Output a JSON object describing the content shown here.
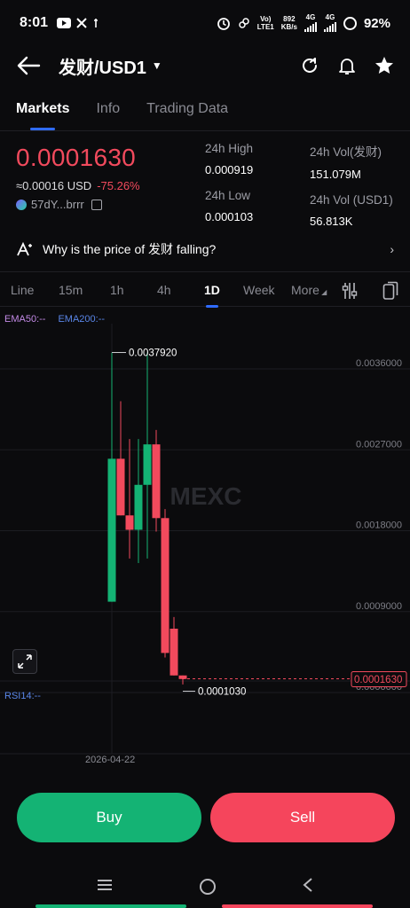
{
  "status_bar": {
    "time": "8:01",
    "left_icons": [
      "youtube-icon",
      "x-icon",
      "notification-icon"
    ],
    "network_label_1": "Vo)",
    "network_label_2": "LTE1",
    "net_speed_value": "892",
    "net_speed_unit": "KB/s",
    "network_type_1": "4G",
    "network_type_2": "4G",
    "battery": "92%"
  },
  "header": {
    "pair": "发财/USD1",
    "icons": [
      "back-arrow-icon",
      "refresh-icon",
      "bell-icon",
      "star-icon"
    ]
  },
  "tabs": [
    {
      "label": "Markets",
      "active": true
    },
    {
      "label": "Info",
      "active": false
    },
    {
      "label": "Trading Data",
      "active": false
    }
  ],
  "price": {
    "last": "0.0001630",
    "usd_approx": "≈0.00016 USD",
    "change": "-75.26%",
    "address": "57dY...brrr",
    "color_down": "#f24a5d",
    "color_up": "#14b374"
  },
  "stats": {
    "high_label": "24h High",
    "high_value": "0.000919",
    "low_label": "24h Low",
    "low_value": "0.000103",
    "vol_base_label": "24h Vol(发财)",
    "vol_base_value": "151.079M",
    "vol_quote_label": "24h Vol (USD1)",
    "vol_quote_value": "56.813K"
  },
  "why_row": {
    "text": "Why is the price of 发财 falling?"
  },
  "intervals": {
    "items": [
      "Line",
      "15m",
      "1h",
      "4h",
      "1D",
      "Week",
      "More"
    ],
    "active": "1D",
    "icons": [
      "indicator-settings-icon",
      "copy-layout-icon"
    ]
  },
  "indicators": {
    "ema50": "EMA50:--",
    "ema200": "EMA200:--",
    "rsi": "RSI14:--"
  },
  "chart": {
    "watermark": "MEXC",
    "price_axis": [
      "0.0036000",
      "0.0027000",
      "0.0018000",
      "0.0009000",
      "0.0000000"
    ],
    "current_price_tag": "0.0001630",
    "high_marker": "0.0037920",
    "low_marker": "0.0001030",
    "date_label": "2026-04-22"
  },
  "chart_data": {
    "type": "candlestick",
    "ylim": [
      0,
      0.004
    ],
    "y_ticks": [
      0.0036,
      0.0027,
      0.0018,
      0.0009,
      0.0
    ],
    "max_label": 0.003792,
    "min_label": 0.000103,
    "last_price": 0.000163,
    "x_label": "2026-04-22",
    "candles": [
      {
        "open": 0.00102,
        "close": 0.00261,
        "high": 0.00379,
        "low": 0.00102
      },
      {
        "open": 0.00261,
        "close": 0.00198,
        "high": 0.00325,
        "low": 0.00198
      },
      {
        "open": 0.00198,
        "close": 0.00182,
        "high": 0.00283,
        "low": 0.0015
      },
      {
        "open": 0.00182,
        "close": 0.00232,
        "high": 0.00283,
        "low": 0.00145
      },
      {
        "open": 0.00232,
        "close": 0.00277,
        "high": 0.00379,
        "low": 0.0015
      },
      {
        "open": 0.00277,
        "close": 0.00195,
        "high": 0.00293,
        "low": 0.0018
      },
      {
        "open": 0.00195,
        "close": 0.00045,
        "high": 0.00205,
        "low": 0.0004
      },
      {
        "open": 0.00072,
        "close": 0.0002,
        "high": 0.00085,
        "low": 0.0002
      },
      {
        "open": 0.0002,
        "close": 0.00016,
        "high": 0.0002,
        "low": 0.0001
      }
    ]
  },
  "actions": {
    "buy": "Buy",
    "sell": "Sell"
  },
  "nav": {
    "icons": [
      "recent-apps-icon",
      "home-icon",
      "back-icon"
    ]
  }
}
